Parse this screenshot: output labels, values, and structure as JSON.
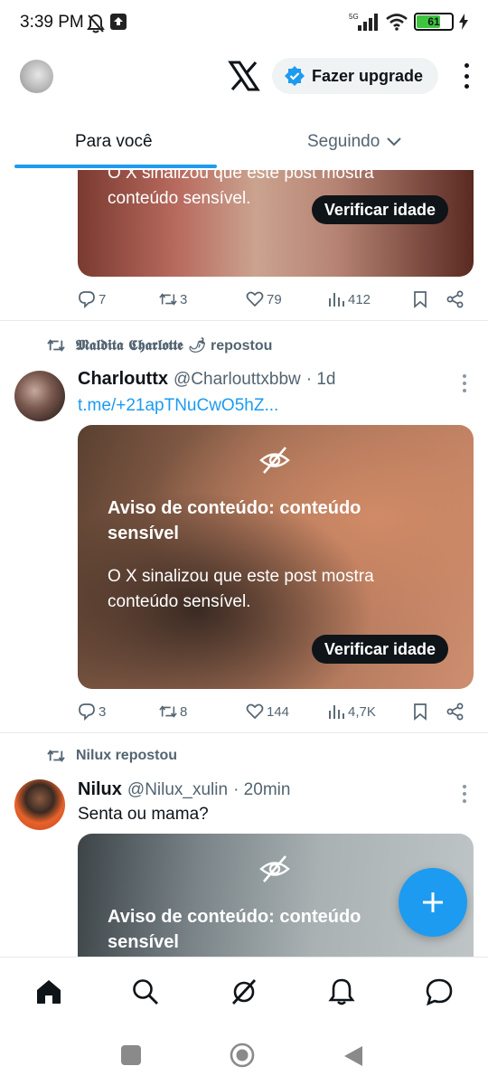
{
  "status_bar": {
    "time": "3:39 PM",
    "network": "5G",
    "battery_level": "61"
  },
  "header": {
    "upgrade_label": "Fazer upgrade"
  },
  "tabs": {
    "for_you": "Para você",
    "following": "Seguindo"
  },
  "feed": {
    "post0": {
      "media_sub": "O X sinalizou que este post mostra conteúdo sensível.",
      "verify_label": "Verificar idade",
      "replies": "7",
      "reposts": "3",
      "likes": "79",
      "views": "412"
    },
    "post1": {
      "reposter": "𝕸𝖆𝖑𝖉𝖎𝖙𝖆 𝕮𝖍𝖆𝖗𝖑𝖔𝖙𝖙𝖊 🌶",
      "reposted_label": "repostou",
      "name": "Charlouttx",
      "handle": "@Charlouttxbbw",
      "time": "· 1d",
      "link": "t.me/+21apTNuCwO5hZ...",
      "media_title": "Aviso de conteúdo: conteúdo sensível",
      "media_sub": "O X sinalizou que este post mostra conteúdo sensível.",
      "verify_label": "Verificar idade",
      "replies": "3",
      "reposts": "8",
      "likes": "144",
      "views": "4,7K"
    },
    "post2": {
      "reposter": "Nilux repostou",
      "name": "Nilux",
      "handle": "@Nilux_xulin",
      "time": "· 20min",
      "text": "Senta ou mama?",
      "media_title": "Aviso de conteúdo: conteúdo sensível"
    }
  },
  "colors": {
    "accent": "#1d9bf0",
    "text_primary": "#0f1419",
    "text_secondary": "#536471"
  }
}
